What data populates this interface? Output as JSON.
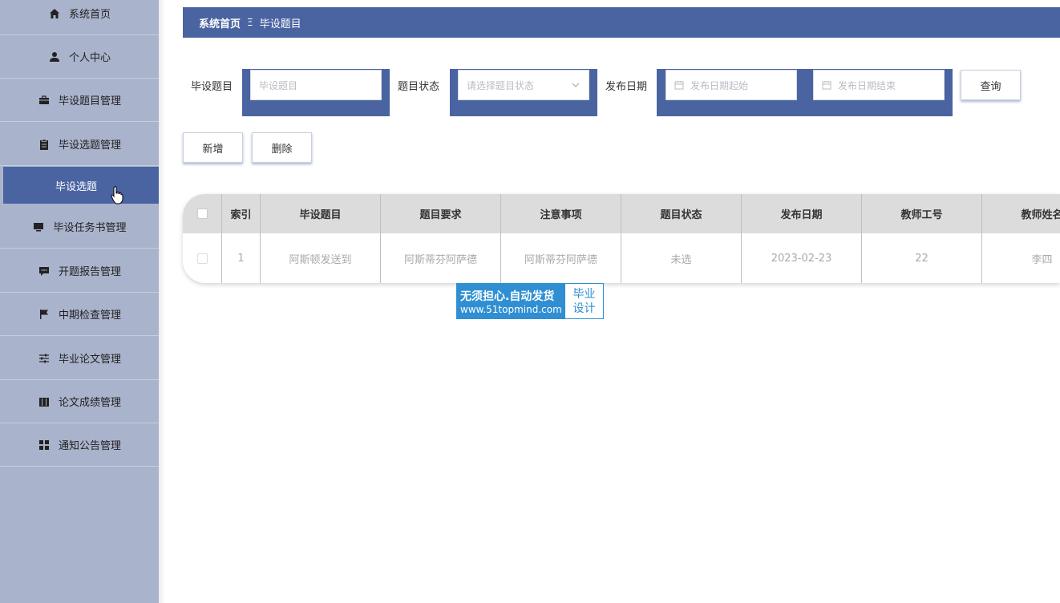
{
  "sidebar": {
    "items": [
      {
        "label": "系统首页",
        "icon": "home-icon"
      },
      {
        "label": "个人中心",
        "icon": "user-icon"
      },
      {
        "label": "毕设题目管理",
        "icon": "briefcase-icon"
      },
      {
        "label": "毕设选题管理",
        "icon": "clipboard-icon"
      },
      {
        "label": "毕设选题",
        "icon": "",
        "active": true
      },
      {
        "label": "毕设任务书管理",
        "icon": "monitor-icon"
      },
      {
        "label": "开题报告管理",
        "icon": "comment-icon"
      },
      {
        "label": "中期检查管理",
        "icon": "flag-icon"
      },
      {
        "label": "毕业论文管理",
        "icon": "sliders-icon"
      },
      {
        "label": "论文成绩管理",
        "icon": "book-icon"
      },
      {
        "label": "通知公告管理",
        "icon": "grid-icon"
      }
    ],
    "accent_color": "#4a64a2"
  },
  "breadcrumb": {
    "home": "系统首页",
    "separator": "Ξ",
    "current": "毕设题目"
  },
  "search": {
    "title_label": "毕设题目",
    "title_placeholder": "毕设题目",
    "status_label": "题目状态",
    "status_placeholder": "请选择题目状态",
    "date_label": "发布日期",
    "date_start_placeholder": "发布日期起始",
    "date_end_placeholder": "发布日期结束",
    "query_button": "查询"
  },
  "actions": {
    "add_button": "新增",
    "delete_button": "删除"
  },
  "table": {
    "headers": [
      "索引",
      "毕设题目",
      "题目要求",
      "注意事项",
      "题目状态",
      "发布日期",
      "教师工号",
      "教师姓名"
    ],
    "rows": [
      [
        "1",
        "阿斯顿发送到",
        "阿斯蒂芬阿萨德",
        "阿斯蒂芬阿萨德",
        "未选",
        "2023-02-23",
        "22",
        "李四"
      ]
    ]
  },
  "watermark": {
    "line1": "无须担心.自动发货",
    "line2": "www.51topmind.com",
    "right_line1": "毕业",
    "right_line2": "设计"
  }
}
